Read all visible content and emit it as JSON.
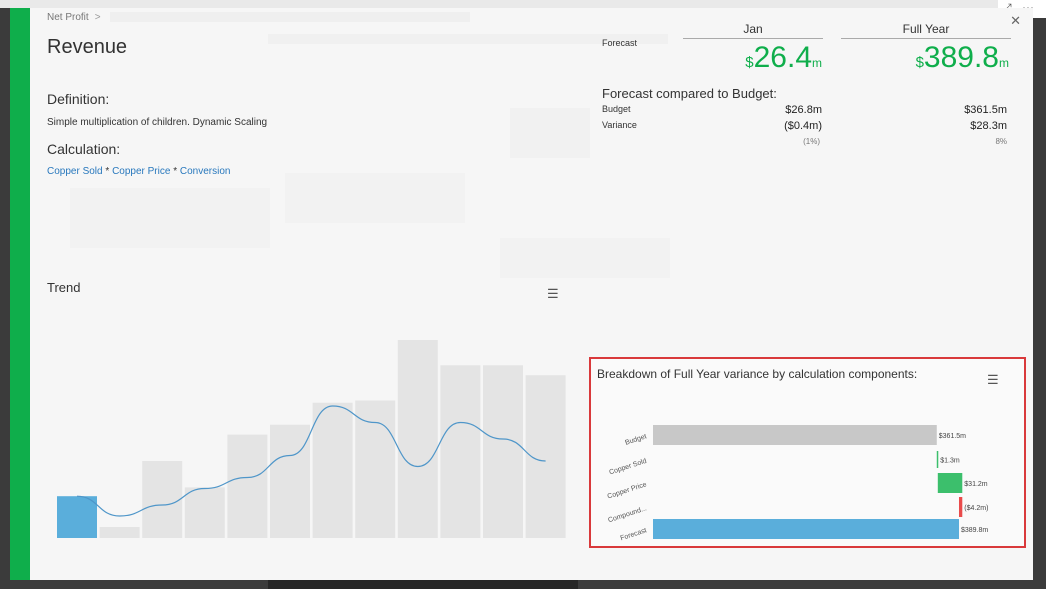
{
  "breadcrumb": {
    "current": "Net Profit",
    "separator": ">"
  },
  "title": "Revenue",
  "definition": {
    "heading": "Definition:",
    "text": "Simple multiplication of children. Dynamic Scaling"
  },
  "calculation": {
    "heading": "Calculation:",
    "terms": [
      "Copper Sold",
      "Copper Price",
      "Conversion"
    ],
    "operator": "*"
  },
  "forecast": {
    "label": "Forecast",
    "jan": {
      "header": "Jan",
      "currency": "$",
      "value": "26.4",
      "suffix": "m"
    },
    "full_year": {
      "header": "Full Year",
      "currency": "$",
      "value": "389.8",
      "suffix": "m"
    }
  },
  "comparison": {
    "title": "Forecast compared to Budget:",
    "budget": {
      "label": "Budget",
      "jan": "$26.8m",
      "full_year": "$361.5m"
    },
    "variance": {
      "label": "Variance",
      "jan": "($0.4m)",
      "full_year": "$28.3m"
    },
    "pct": {
      "jan": "(1%)",
      "full_year": "8%"
    }
  },
  "trend": {
    "title": "Trend",
    "menu_icon": "hamburger-menu-icon"
  },
  "breakdown": {
    "title": "Breakdown of Full Year variance by calculation components:",
    "menu_icon": "hamburger-menu-icon"
  },
  "colors": {
    "accent": "#0fae4b",
    "positive": "#3cbf6c",
    "negative": "#e94b4b",
    "forecast_bar": "#5aaedb",
    "budget_bar": "#c8c8c8",
    "highlight_border": "#d9393b",
    "trend_line": "#4f96c9"
  },
  "chart_data": [
    {
      "type": "bar",
      "categories": [
        "1",
        "2",
        "3",
        "4",
        "5",
        "6",
        "7",
        "8",
        "9",
        "10",
        "11",
        "12"
      ],
      "series": [
        {
          "values": [
            38,
            10,
            70,
            46,
            94,
            103,
            123,
            125,
            180,
            157,
            157,
            148
          ]
        },
        {
          "values": [
            38,
            20,
            30,
            45,
            55,
            75,
            120,
            105,
            65,
            105,
            90,
            70
          ]
        }
      ],
      "highlighted_index": 0,
      "ylim": [
        0,
        200
      ]
    },
    {
      "type": "bar",
      "categories": [
        "Budget",
        "Copper Sold",
        "Copper Price",
        "Compound...",
        "Forecast"
      ],
      "values": [
        361.5,
        1.3,
        31.2,
        -4.2,
        389.8
      ],
      "labels": [
        "$361.5m",
        "$1.3m",
        "$31.2m",
        "($4.2m)",
        "$389.8m"
      ],
      "xlim": [
        0,
        400
      ]
    }
  ]
}
